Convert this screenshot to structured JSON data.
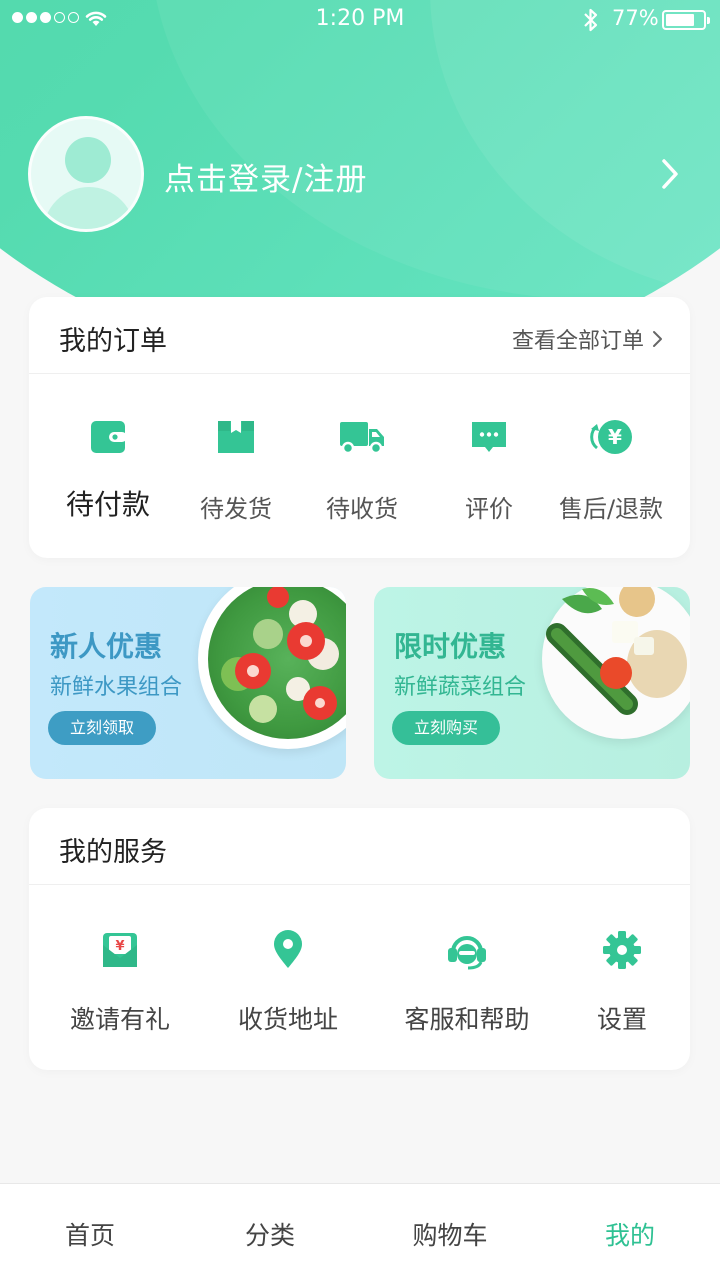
{
  "status_bar": {
    "time": "1:20 PM",
    "battery": "77%",
    "battery_level": 0.77,
    "icons": [
      "signal-icon",
      "wifi-icon",
      "bluetooth-icon",
      "battery-icon"
    ]
  },
  "profile": {
    "login_label": "点击登录/注册"
  },
  "orders": {
    "title": "我的订单",
    "view_all": "查看全部订单",
    "items": [
      {
        "label": "待付款",
        "icon": "wallet-icon"
      },
      {
        "label": "待发货",
        "icon": "package-icon"
      },
      {
        "label": "待收货",
        "icon": "truck-icon"
      },
      {
        "label": "评价",
        "icon": "comment-icon"
      },
      {
        "label": "售后/退款",
        "icon": "refund-icon"
      }
    ]
  },
  "promos": [
    {
      "title": "新人优惠",
      "subtitle": "新鲜水果组合",
      "button": "立刻领取"
    },
    {
      "title": "限时优惠",
      "subtitle": "新鲜蔬菜组合",
      "button": "立刻购买"
    }
  ],
  "services": {
    "title": "我的服务",
    "items": [
      {
        "label": "邀请有礼",
        "icon": "red-envelope-icon"
      },
      {
        "label": "收货地址",
        "icon": "location-icon"
      },
      {
        "label": "客服和帮助",
        "icon": "headset-icon"
      },
      {
        "label": "设置",
        "icon": "gear-icon"
      }
    ]
  },
  "tabs": [
    {
      "label": "首页"
    },
    {
      "label": "分类"
    },
    {
      "label": "购物车"
    },
    {
      "label": "我的",
      "active": true
    }
  ],
  "colors": {
    "accent": "#2fc193",
    "header_gradient_start": "#4cd3a2",
    "header_gradient_end": "#6ce8c9",
    "promo_blue": "#3e9dc4",
    "promo_green": "#35bf98"
  }
}
